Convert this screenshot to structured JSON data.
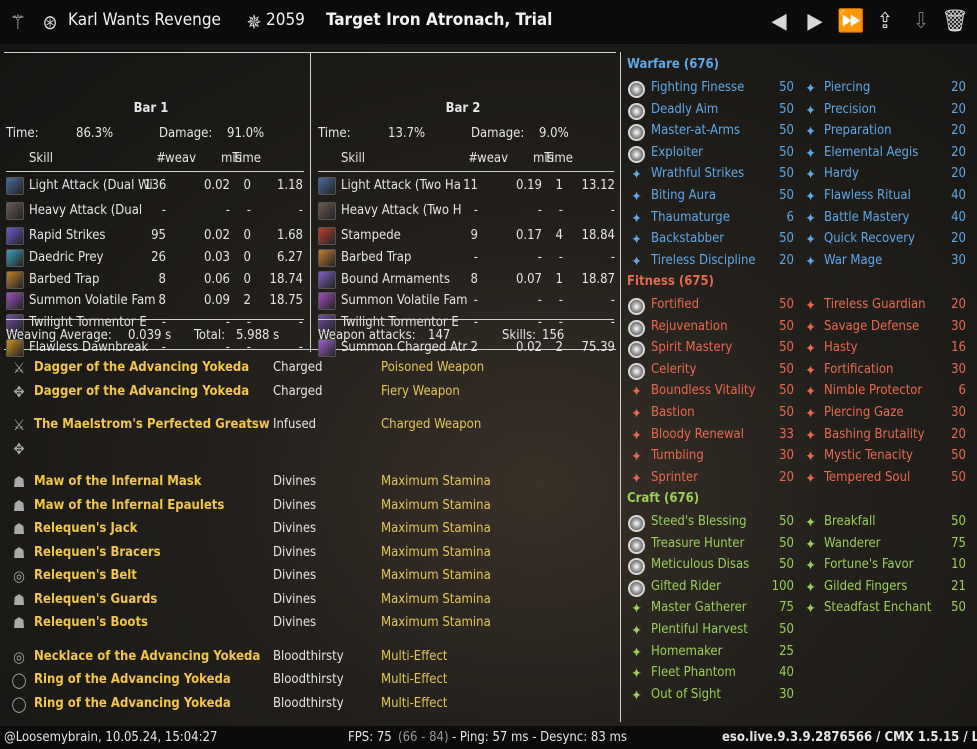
{
  "header": {
    "player": "Karl Wants Revenge",
    "cp": "2059",
    "target": "Target Iron Atronach, Trial"
  },
  "bars": [
    {
      "title": "Bar 1",
      "time_label": "Time:",
      "time": "86.3%",
      "damage_label": "Damage:",
      "damage": "91.0%",
      "cols": [
        "Skill",
        "#",
        "weav",
        "mis",
        "Time"
      ],
      "rows": [
        {
          "skill": "Light Attack (Dual Wi",
          "n": "136",
          "weav": "0.02",
          "mis": "0",
          "time": "1.18",
          "color": "#4a6aa0"
        },
        {
          "skill": "Heavy Attack (Dual",
          "n": "-",
          "weav": "-",
          "mis": "-",
          "time": "-",
          "color": "#6a5a50"
        },
        {
          "skill": "Rapid Strikes",
          "n": "95",
          "weav": "0.02",
          "mis": "0",
          "time": "1.68",
          "color": "#6a5ad0"
        },
        {
          "skill": "Daedric Prey",
          "n": "26",
          "weav": "0.03",
          "mis": "0",
          "time": "6.27",
          "color": "#3aa0c0"
        },
        {
          "skill": "Barbed Trap",
          "n": "8",
          "weav": "0.06",
          "mis": "0",
          "time": "18.74",
          "color": "#c08030"
        },
        {
          "skill": "Summon Volatile Fam",
          "n": "8",
          "weav": "0.09",
          "mis": "2",
          "time": "18.75",
          "color": "#a050c0"
        },
        {
          "skill": "Twilight Tormentor E",
          "n": "-",
          "weav": "-",
          "mis": "-",
          "time": "-",
          "color": "#7050a0"
        },
        {
          "skill": "Flawless Dawnbreak",
          "n": "-",
          "weav": "-",
          "mis": "-",
          "time": "-",
          "color": "#d09020"
        }
      ],
      "footer_left_label": "Weaving Average:",
      "footer_left": "0.039 s",
      "footer_right_label": "Total:",
      "footer_right": "5.988 s"
    },
    {
      "title": "Bar 2",
      "time_label": "Time:",
      "time": "13.7%",
      "damage_label": "Damage:",
      "damage": "9.0%",
      "cols": [
        "Skill",
        "#",
        "weav",
        "mis",
        "Time"
      ],
      "rows": [
        {
          "skill": "Light Attack (Two Ha",
          "n": "11",
          "weav": "0.19",
          "mis": "1",
          "time": "13.12",
          "color": "#4a6aa0"
        },
        {
          "skill": "Heavy Attack (Two H",
          "n": "-",
          "weav": "-",
          "mis": "-",
          "time": "-",
          "color": "#6a5a50"
        },
        {
          "skill": "Stampede",
          "n": "9",
          "weav": "0.17",
          "mis": "4",
          "time": "18.84",
          "color": "#c04030"
        },
        {
          "skill": "Barbed Trap",
          "n": "-",
          "weav": "-",
          "mis": "-",
          "time": "-",
          "color": "#c08030"
        },
        {
          "skill": "Bound Armaments",
          "n": "8",
          "weav": "0.07",
          "mis": "1",
          "time": "18.87",
          "color": "#8060c0"
        },
        {
          "skill": "Summon Volatile Fam",
          "n": "-",
          "weav": "-",
          "mis": "-",
          "time": "-",
          "color": "#a050c0"
        },
        {
          "skill": "Twilight Tormentor E",
          "n": "-",
          "weav": "-",
          "mis": "-",
          "time": "-",
          "color": "#7050a0"
        },
        {
          "skill": "Summon Charged Atr",
          "n": "2",
          "weav": "0.02",
          "mis": "2",
          "time": "75.39",
          "color": "#a060d0"
        }
      ],
      "footer_left_label": "Weapon attacks:",
      "footer_left": "147",
      "footer_right_label": "Skills:",
      "footer_right": "156"
    }
  ],
  "gear": [
    {
      "name": "Dagger of the Advancing Yokeda",
      "trait": "Charged",
      "enchant": "Poisoned Weapon",
      "icon": "dagger-icon",
      "glyph": "⚔"
    },
    {
      "name": "Dagger of the Advancing Yokeda",
      "trait": "Charged",
      "enchant": "Fiery Weapon",
      "icon": "dagger-icon",
      "glyph": "✥"
    },
    {
      "name": "The Maelstrom's Perfected Greatswor",
      "trait": "Infused",
      "enchant": "Charged Weapon",
      "icon": "greatsword-icon",
      "glyph": "⚔"
    },
    {
      "name": "",
      "trait": "",
      "enchant": "",
      "icon": "empty-slot-icon",
      "glyph": "✥"
    },
    {
      "name": "Maw of the Infernal Mask",
      "trait": "Divines",
      "enchant": "Maximum Stamina",
      "icon": "helmet-icon",
      "glyph": "☗"
    },
    {
      "name": "Maw of the Infernal Epaulets",
      "trait": "Divines",
      "enchant": "Maximum Stamina",
      "icon": "shoulders-icon",
      "glyph": "☗"
    },
    {
      "name": "Relequen's Jack",
      "trait": "Divines",
      "enchant": "Maximum Stamina",
      "icon": "chest-icon",
      "glyph": "☗"
    },
    {
      "name": "Relequen's Bracers",
      "trait": "Divines",
      "enchant": "Maximum Stamina",
      "icon": "bracers-icon",
      "glyph": "☗"
    },
    {
      "name": "Relequen's Belt",
      "trait": "Divines",
      "enchant": "Maximum Stamina",
      "icon": "belt-icon",
      "glyph": "◎"
    },
    {
      "name": "Relequen's Guards",
      "trait": "Divines",
      "enchant": "Maximum Stamina",
      "icon": "legs-icon",
      "glyph": "☗"
    },
    {
      "name": "Relequen's Boots",
      "trait": "Divines",
      "enchant": "Maximum Stamina",
      "icon": "boots-icon",
      "glyph": "☗"
    },
    {
      "name": "Necklace of the Advancing Yokeda",
      "trait": "Bloodthirsty",
      "enchant": "Multi-Effect",
      "icon": "necklace-icon",
      "glyph": "◎"
    },
    {
      "name": "Ring of the Advancing Yokeda",
      "trait": "Bloodthirsty",
      "enchant": "Multi-Effect",
      "icon": "ring-icon",
      "glyph": "◯"
    },
    {
      "name": "Ring of the Advancing Yokeda",
      "trait": "Bloodthirsty",
      "enchant": "Multi-Effect",
      "icon": "ring-icon",
      "glyph": "◯"
    }
  ],
  "cp": {
    "warfare": {
      "title": "Warfare (676)",
      "color": "#5fa8e8",
      "left": [
        {
          "n": "Fighting Finesse",
          "v": "50",
          "big": true
        },
        {
          "n": "Deadly Aim",
          "v": "50",
          "big": true
        },
        {
          "n": "Master-at-Arms",
          "v": "50",
          "big": true
        },
        {
          "n": "Exploiter",
          "v": "50",
          "big": true
        },
        {
          "n": "Wrathful Strikes",
          "v": "50"
        },
        {
          "n": "Biting Aura",
          "v": "50"
        },
        {
          "n": "Thaumaturge",
          "v": "6"
        },
        {
          "n": "Backstabber",
          "v": "50"
        },
        {
          "n": "Tireless Discipline",
          "v": "20"
        }
      ],
      "right": [
        {
          "n": "Piercing",
          "v": "20"
        },
        {
          "n": "Precision",
          "v": "20"
        },
        {
          "n": "Preparation",
          "v": "20"
        },
        {
          "n": "Elemental Aegis",
          "v": "20"
        },
        {
          "n": "Hardy",
          "v": "20"
        },
        {
          "n": "Flawless Ritual",
          "v": "40"
        },
        {
          "n": "Battle Mastery",
          "v": "40"
        },
        {
          "n": "Quick Recovery",
          "v": "20"
        },
        {
          "n": "War Mage",
          "v": "30"
        }
      ]
    },
    "fitness": {
      "title": "Fitness (675)",
      "color": "#e86a50",
      "left": [
        {
          "n": "Fortified",
          "v": "50",
          "big": true
        },
        {
          "n": "Rejuvenation",
          "v": "50",
          "big": true
        },
        {
          "n": "Spirit Mastery",
          "v": "50",
          "big": true
        },
        {
          "n": "Celerity",
          "v": "50",
          "big": true
        },
        {
          "n": "Boundless Vitality",
          "v": "50"
        },
        {
          "n": "Bastion",
          "v": "50"
        },
        {
          "n": "Bloody Renewal",
          "v": "33"
        },
        {
          "n": "Tumbling",
          "v": "30"
        },
        {
          "n": "Sprinter",
          "v": "20"
        }
      ],
      "right": [
        {
          "n": "Tireless Guardian",
          "v": "20"
        },
        {
          "n": "Savage Defense",
          "v": "30"
        },
        {
          "n": "Hasty",
          "v": "16"
        },
        {
          "n": "Fortification",
          "v": "30"
        },
        {
          "n": "Nimble Protector",
          "v": "6"
        },
        {
          "n": "Piercing Gaze",
          "v": "30"
        },
        {
          "n": "Bashing Brutality",
          "v": "20"
        },
        {
          "n": "Mystic Tenacity",
          "v": "50"
        },
        {
          "n": "Tempered Soul",
          "v": "50"
        }
      ]
    },
    "craft": {
      "title": "Craft (676)",
      "color": "#9ad05a",
      "left": [
        {
          "n": "Steed's Blessing",
          "v": "50",
          "big": true
        },
        {
          "n": "Treasure Hunter",
          "v": "50",
          "big": true
        },
        {
          "n": "Meticulous Disas",
          "v": "50",
          "big": true
        },
        {
          "n": "Gifted Rider",
          "v": "100",
          "big": true
        },
        {
          "n": "Master Gatherer",
          "v": "75"
        },
        {
          "n": "Plentiful Harvest",
          "v": "50"
        },
        {
          "n": "Homemaker",
          "v": "25"
        },
        {
          "n": "Fleet Phantom",
          "v": "40"
        },
        {
          "n": "Out of Sight",
          "v": "30"
        }
      ],
      "right": [
        {
          "n": "Breakfall",
          "v": "50"
        },
        {
          "n": "Wanderer",
          "v": "75"
        },
        {
          "n": "Fortune's Favor",
          "v": "10"
        },
        {
          "n": "Gilded Fingers",
          "v": "21"
        },
        {
          "n": "Steadfast Enchant",
          "v": "50"
        }
      ]
    }
  },
  "footer": {
    "left": "@Loosemybrain, 10.05.24, 15:04:27",
    "fps_label": "FPS: 75",
    "fps_range": "(66 - 84)",
    "ping": "- Ping: 57 ms - Desync: 83 ms",
    "version": "eso.live.9.3.9.2876566 / CMX 1.5.15 / LC 73"
  },
  "colors": {
    "gear_name": "#f2c64c",
    "gear_trait": "#e6c65a",
    "warfare": "#5fa8e8",
    "fitness": "#e86a50",
    "craft": "#9ad05a"
  }
}
